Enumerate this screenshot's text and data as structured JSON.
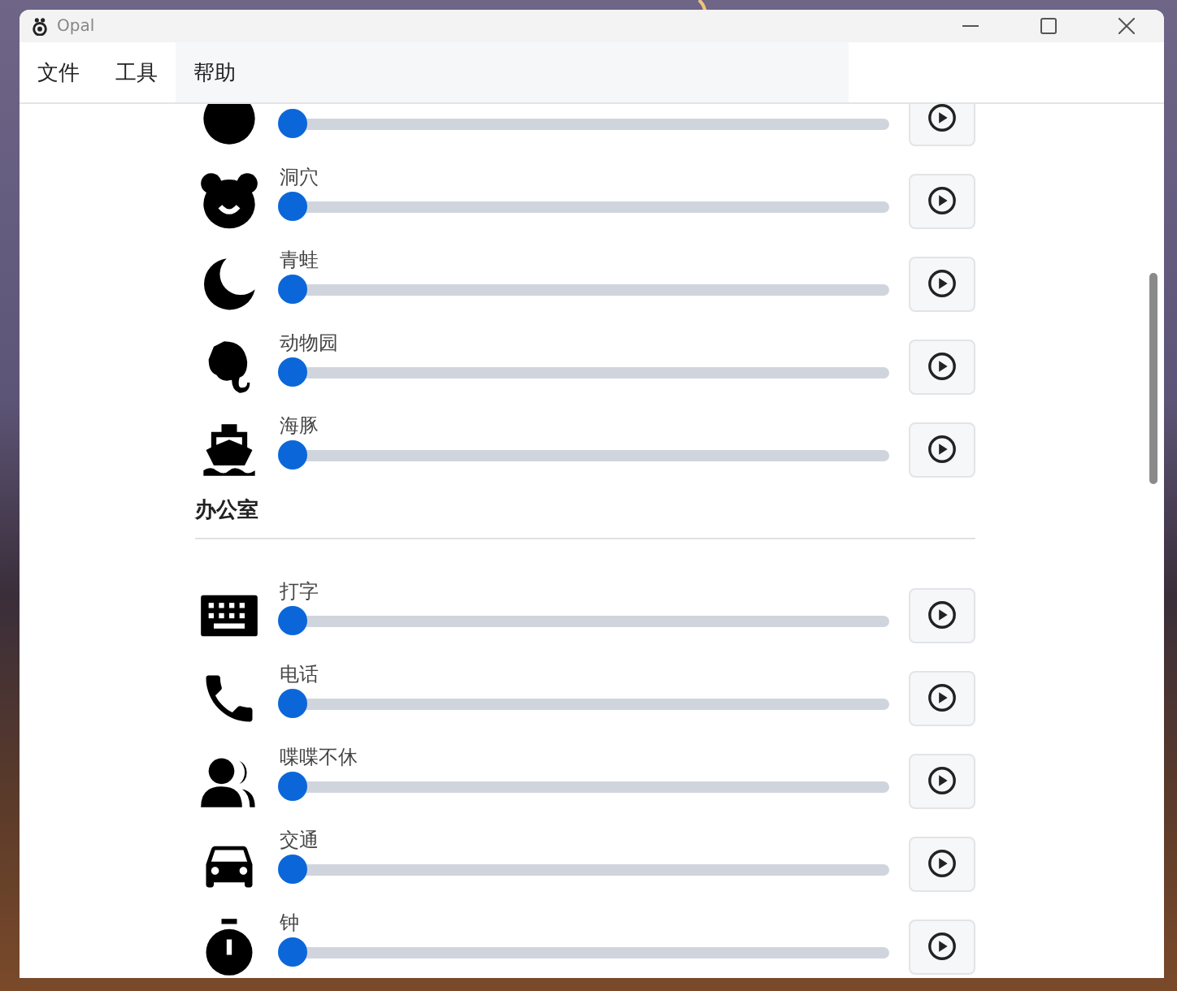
{
  "window": {
    "title": "Opal"
  },
  "menu": [
    {
      "label": "文件",
      "selected": false
    },
    {
      "label": "工具",
      "selected": false
    },
    {
      "label": "帮助",
      "selected": true
    }
  ],
  "sections": [
    {
      "sounds": [
        {
          "level": 0
        },
        {
          "label": "洞穴",
          "level": 0
        },
        {
          "label": "青蛙",
          "level": 0
        },
        {
          "label": "动物园",
          "level": 0
        },
        {
          "label": "海豚",
          "level": 0
        }
      ]
    },
    {
      "title": "办公室",
      "sounds": [
        {
          "label": "打字",
          "level": 0
        },
        {
          "label": "电话",
          "level": 0
        },
        {
          "label": "喋喋不休",
          "level": 0
        },
        {
          "label": "交通",
          "level": 0
        },
        {
          "label": "钟",
          "level": 0
        }
      ]
    }
  ]
}
